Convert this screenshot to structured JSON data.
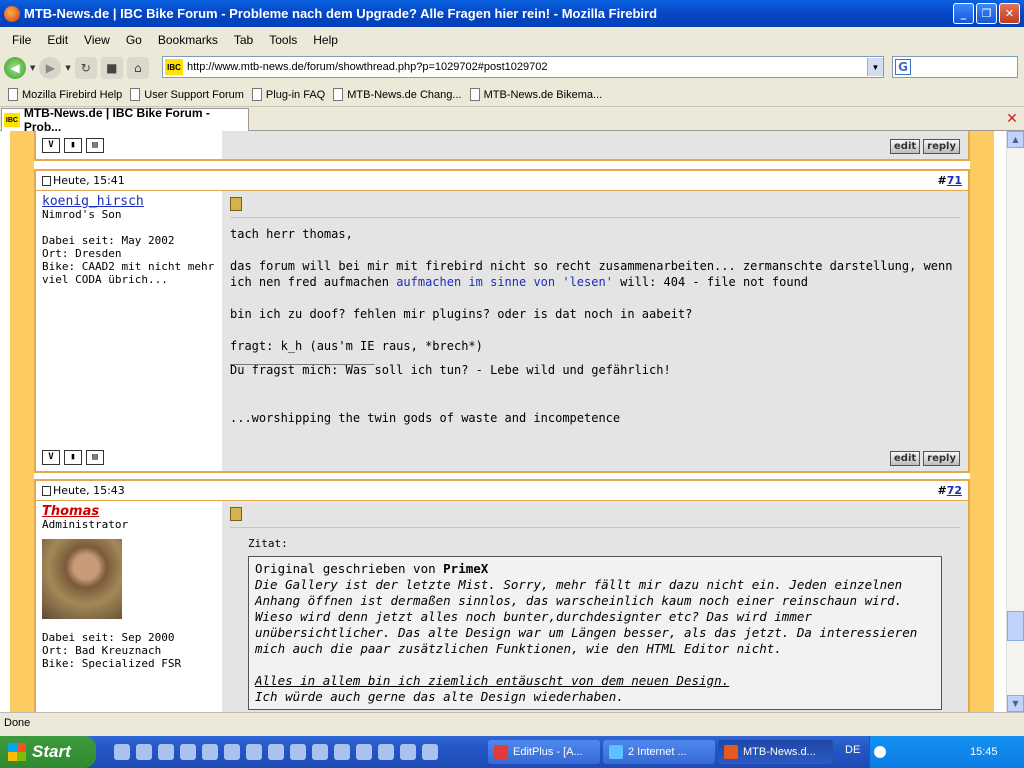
{
  "window": {
    "title": "MTB-News.de | IBC Bike Forum - Probleme nach dem Upgrade? Alle Fragen hier rein! - Mozilla Firebird"
  },
  "menu": [
    "File",
    "Edit",
    "View",
    "Go",
    "Bookmarks",
    "Tab",
    "Tools",
    "Help"
  ],
  "nav": {
    "url": "http://www.mtb-news.de/forum/showthread.php?p=1029702#post1029702",
    "search_value": "",
    "favicon_text": "IBC",
    "search_logo": "G"
  },
  "bookmarks": [
    "Mozilla Firebird Help",
    "User Support Forum",
    "Plug-in FAQ",
    "MTB-News.de Chang...",
    "MTB-News.de Bikema..."
  ],
  "tab": {
    "label": "MTB-News.de | IBC Bike Forum - Prob...",
    "close": "✕"
  },
  "post_actions": {
    "edit": "edit",
    "reply": "reply"
  },
  "posts": [
    {
      "time": "Heute, 15:41",
      "num_prefix": "#",
      "num": "71",
      "username": "koenig_hirsch",
      "user_title": "Nimrod's Son",
      "info": [
        "Dabei seit: May 2002",
        "Ort: Dresden",
        "Bike: CAAD2 mit nicht mehr viel CODA übrich..."
      ],
      "body": {
        "line1": "tach herr thomas,",
        "line2a": "das forum will bei mir mit firebird nicht so recht zusammenarbeiten... zermanschte darstellung, wenn ich nen fred aufmachen",
        "line2link": "aufmachen im sinne von 'lesen'",
        "line2b": "will: 404 - file not found",
        "line3": "bin ich zu doof? fehlen mir plugins? oder is dat noch in aabeit?",
        "line4": "fragt: k_h (aus'm IE raus, *brech*)",
        "sig_rule": "____________________",
        "sig1": "Du fragst mich: Was soll ich tun? - Lebe wild und gefährlich!",
        "sig2": "...worshipping the twin gods of waste and incompetence"
      }
    },
    {
      "time": "Heute, 15:43",
      "num_prefix": "#",
      "num": "72",
      "username": "Thomas",
      "user_title": "Administrator",
      "info": [
        "Dabei seit: Sep 2000",
        "Ort: Bad Kreuznach",
        "Bike: Specialized FSR"
      ],
      "quote": {
        "label": "Zitat:",
        "intro": "Original geschrieben von",
        "author": "PrimeX",
        "text1": "Die Gallery ist der letzte Mist. Sorry, mehr fällt mir dazu nicht ein. Jeden einzelnen Anhang öffnen ist dermaßen sinnlos, das warscheinlich kaum noch einer reinschaun wird.",
        "text2": "Wieso wird denn jetzt alles noch bunter,durchdesignter etc? Das wird immer unübersichtlicher. Das alte Design war um Längen besser, als das jetzt. Da interessieren mich auch die paar zusätzlichen Funktionen, wie den HTML Editor nicht.",
        "text3": "Alles in allem bin ich ziemlich entäuscht von dem neuen Design.",
        "text4": "Ich würde auch gerne das alte Design wiederhaben."
      }
    }
  ],
  "status": {
    "text": "Done"
  },
  "taskbar": {
    "start": "Start",
    "buttons": [
      "EditPlus - [A...",
      "2 Internet ...",
      "MTB-News.d..."
    ],
    "lang": "DE",
    "clock": "15:45"
  }
}
